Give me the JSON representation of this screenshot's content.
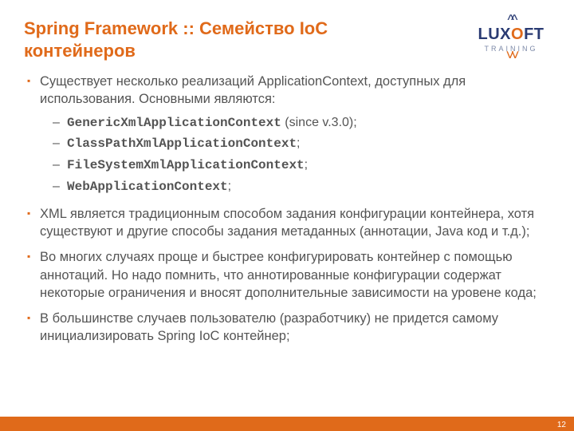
{
  "title": "Spring Framework :: Семейство IoC контейнеров",
  "logo": {
    "brand_l": "LUX",
    "brand_o": "O",
    "brand_r": "FT",
    "sub": "TRAINING"
  },
  "bullets": [
    {
      "text": "Существует несколько реализаций ApplicationContext, доступных для использования. Основными являются:",
      "sub": [
        {
          "code": "GenericXmlApplicationContext",
          "tail": " (since v.3.0);"
        },
        {
          "code": "ClassPathXmlApplicationContext",
          "tail": ";"
        },
        {
          "code": "FileSystemXmlApplicationContext",
          "tail": ";"
        },
        {
          "code": "WebApplicationContext",
          "tail": ";"
        }
      ]
    },
    {
      "text": "XML является традиционным способом задания конфигурации контейнера, хотя существуют и другие способы задания метаданных (аннотации, Java код и т.д.);"
    },
    {
      "text": "Во многих случаях проще и быстрее конфигурировать контейнер с помощью аннотаций. Но надо помнить, что аннотированные конфигурации содержат некоторые ограничения и вносят дополнительные зависимости на уровене кода;"
    },
    {
      "text": "В большинстве случаев пользователю (разработчику) не придется самому инициализировать Spring IoC контейнер;"
    }
  ],
  "page": "12"
}
